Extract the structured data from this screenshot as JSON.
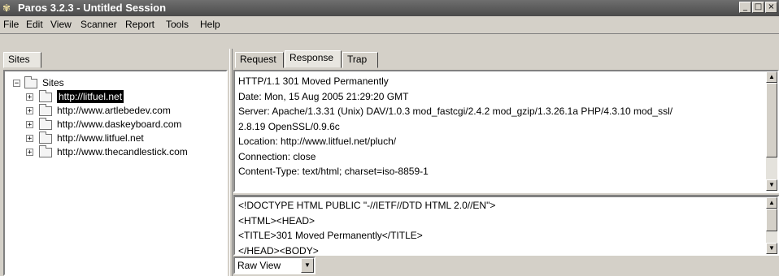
{
  "window": {
    "title": "Paros 3.2.3 - Untitled Session",
    "icon": "paros-app-icon",
    "buttons": {
      "minimize": "_",
      "maximize": "□",
      "close": "×"
    }
  },
  "menu": [
    "File",
    "Edit",
    "View",
    "Scanner",
    "Report",
    "Tools",
    "Help"
  ],
  "left_panel": {
    "tab": "Sites",
    "tree": {
      "root": "Sites",
      "children": [
        "http://litfuel.net",
        "http://www.artlebedev.com",
        "http://www.daskeyboard.com",
        "http://www.litfuel.net",
        "http://www.thecandlestick.com"
      ],
      "selected_index": 0
    }
  },
  "right_panel": {
    "tabs": [
      "Request",
      "Response",
      "Trap"
    ],
    "active_tab": "Response",
    "header_lines": [
      "HTTP/1.1 301 Moved Permanently",
      "Date: Mon, 15 Aug 2005 21:29:20 GMT",
      "Server: Apache/1.3.31 (Unix) DAV/1.0.3 mod_fastcgi/2.4.2 mod_gzip/1.3.26.1a PHP/4.3.10 mod_ssl/",
      "2.8.19 OpenSSL/0.9.6c",
      "Location: http://www.litfuel.net/pluch/",
      "Connection: close",
      "Content-Type: text/html; charset=iso-8859-1"
    ],
    "body_lines": [
      "<!DOCTYPE HTML PUBLIC \"-//IETF//DTD HTML 2.0//EN\">",
      "<HTML><HEAD>",
      "<TITLE>301 Moved Permanently</TITLE>",
      "</HEAD><BODY>"
    ],
    "view_select": {
      "value": "Raw View"
    }
  }
}
